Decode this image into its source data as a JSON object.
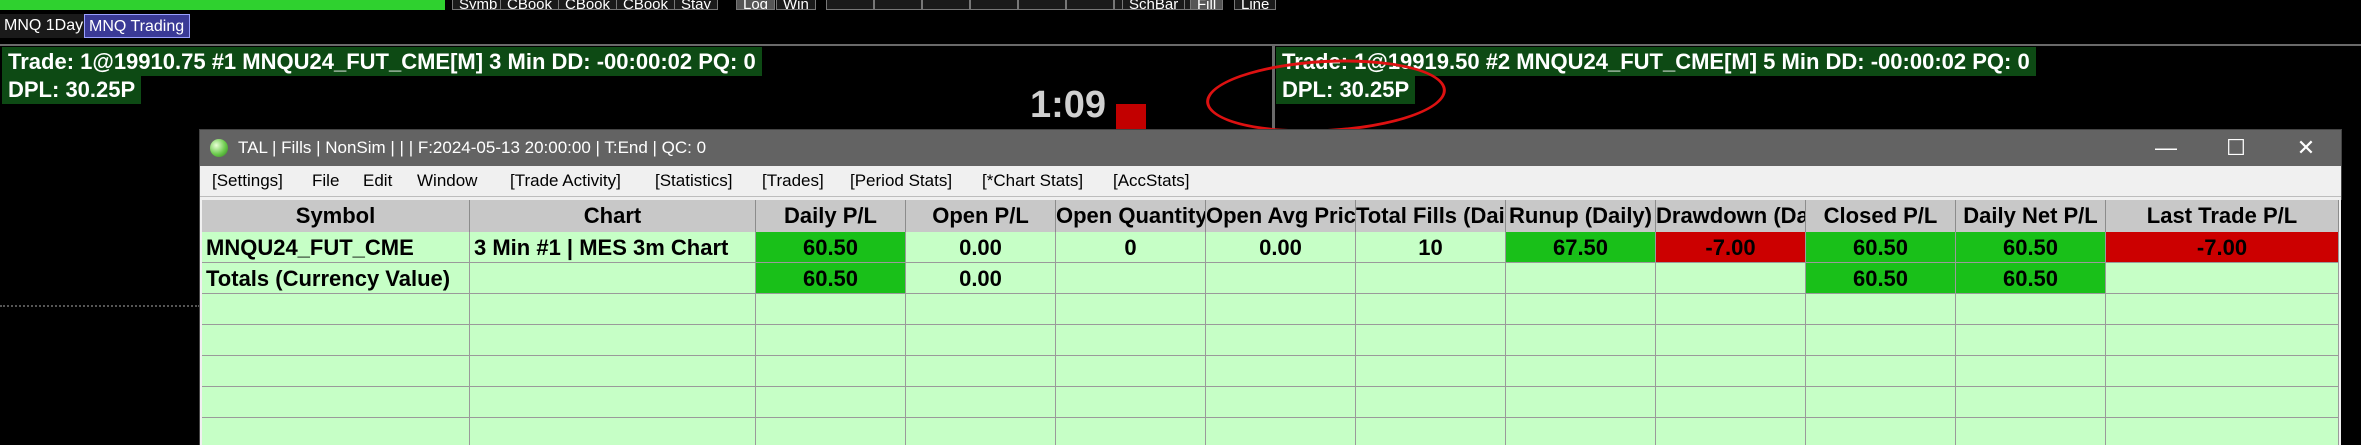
{
  "toolbar": {
    "buttons": [
      "Symb",
      "CBook",
      "CBook",
      "CBook",
      "Stay",
      "Log",
      "Win",
      "",
      "",
      "",
      "",
      "",
      "",
      "",
      "",
      "SchBar",
      "Fill",
      "Line"
    ]
  },
  "tabs": [
    "MNQ 1Day",
    "MNQ Trading"
  ],
  "left_pane": {
    "line1": "Trade: 1@19910.75 #1 MNQU24_FUT_CME[M]  3 Min  DD: -00:00:02 PQ: 0",
    "line2": "DPL: 30.25P",
    "clock": "1:09"
  },
  "right_pane": {
    "line1": "Trade: 1@19919.50 #2 MNQU24_FUT_CME[M]  5 Min  DD: -00:00:02 PQ: 0",
    "line2": "DPL: 30.25P"
  },
  "window": {
    "title": "TAL | Fills | NonSim |  |  | F:2024-05-13  20:00:00 | T:End | QC: 0",
    "menu": [
      "[Settings]",
      "File",
      "Edit",
      "Window",
      "[Trade Activity]",
      "[Statistics]",
      "[Trades]",
      "[Period Stats]",
      "[*Chart Stats]",
      "[AccStats]"
    ],
    "controls": {
      "minimize": "—",
      "maximize": "☐",
      "close": "✕"
    }
  },
  "grid": {
    "headers": [
      "Symbol",
      "Chart",
      "Daily P/L",
      "Open P/L",
      "Open Quantity",
      "Open Avg Price",
      "Total Fills (Daily)",
      "Runup (Daily)",
      "Drawdown (Daily)",
      "Closed P/L",
      "Daily Net P/L",
      "Last Trade P/L"
    ],
    "rows": [
      [
        "MNQU24_FUT_CME",
        "3 Min   #1 | MES 3m Chart",
        "60.50",
        "0.00",
        "0",
        "0.00",
        "10",
        "67.50",
        "-7.00",
        "60.50",
        "60.50",
        "-7.00"
      ],
      [
        "Totals (Currency Value)",
        "",
        "60.50",
        "0.00",
        "",
        "",
        "",
        "",
        "",
        "60.50",
        "60.50",
        ""
      ]
    ]
  },
  "colors": {
    "positive": "#19c019",
    "negative": "#cc0000",
    "grid_bg": "#c6ffc6",
    "pane_info_bg": "#0d4a14",
    "annotation": "#dd1111"
  }
}
